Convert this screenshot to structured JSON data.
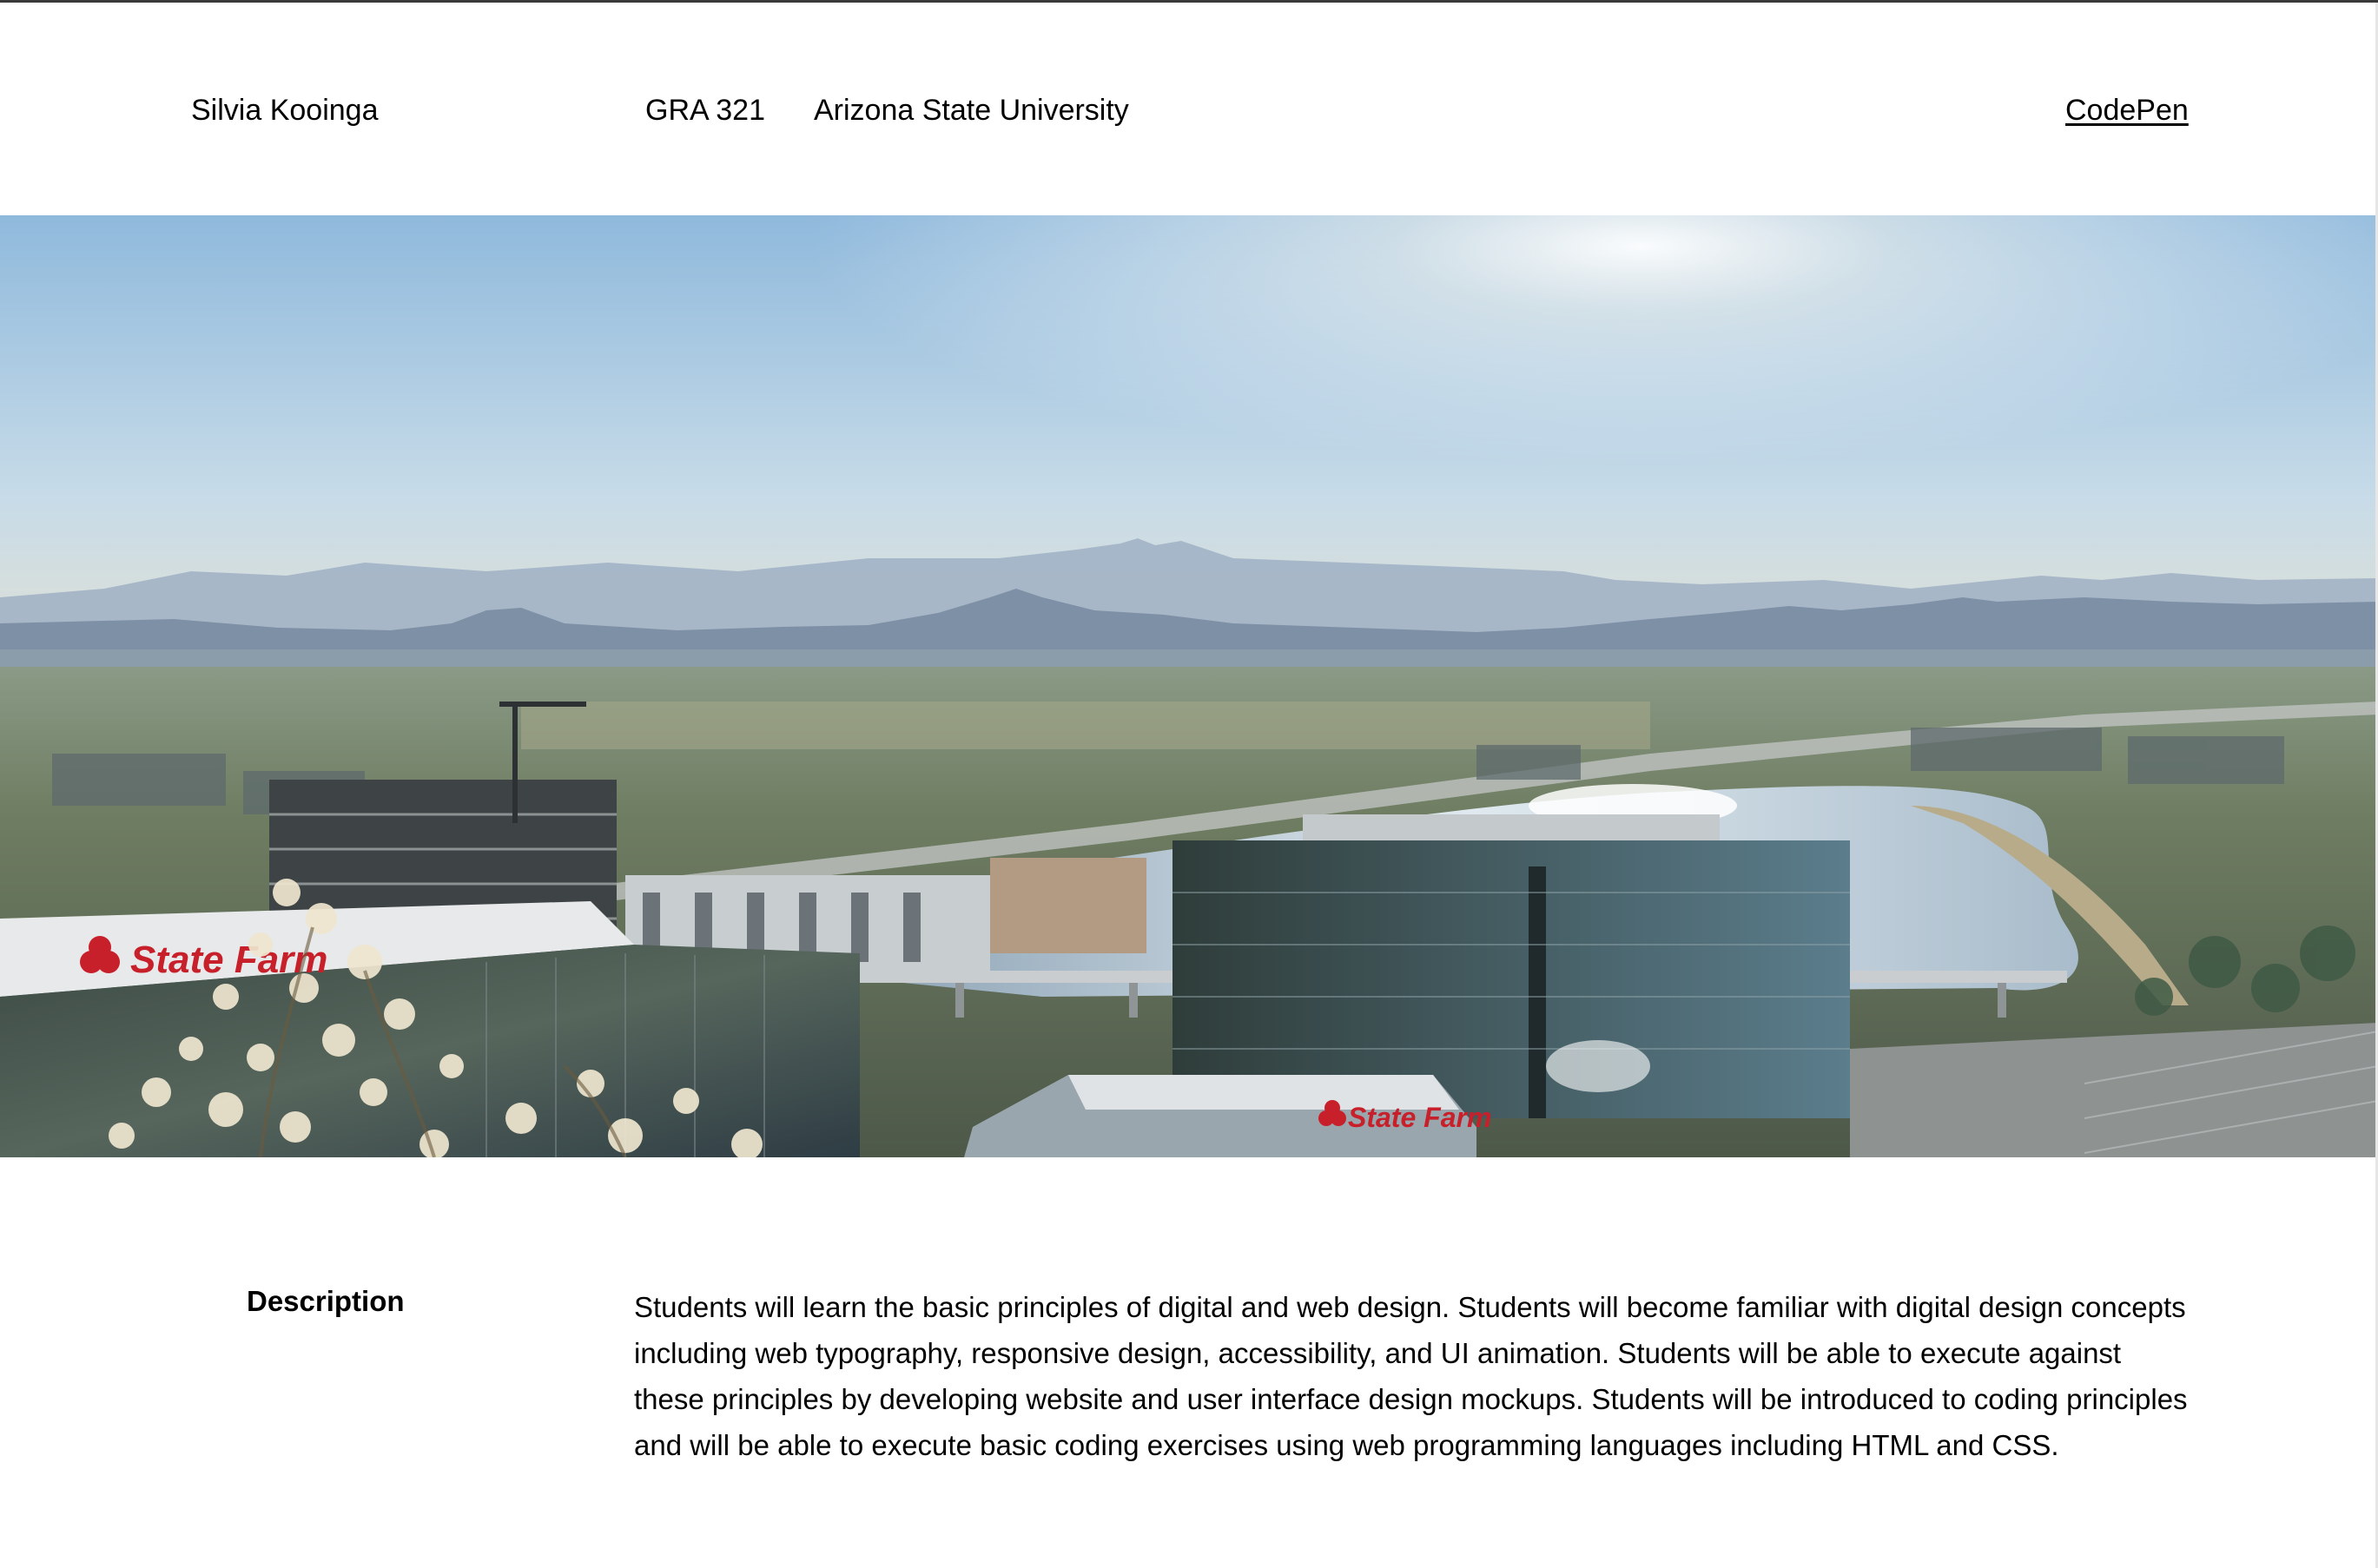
{
  "header": {
    "author": "Silvia Kooinga",
    "course_code": "GRA 321",
    "university": "Arizona State University",
    "link_label": "CodePen"
  },
  "hero": {
    "image_subject": "aerial-city-lake-mountains-photo",
    "signs": [
      "State Farm",
      "State Farm"
    ]
  },
  "description": {
    "label": "Description",
    "text": "Students will learn the basic principles of digital and web design. Students will become familiar with digital design concepts including web typography, responsive design, accessibility, and UI animation. Students will be able to execute against these principles by developing website and user interface design mockups. Students will be introduced to coding principles and will be able to execute basic coding exercises using web programming languages including HTML and CSS."
  },
  "colors": {
    "text": "#000000",
    "background": "#ffffff",
    "sign_red": "#c8202a"
  }
}
